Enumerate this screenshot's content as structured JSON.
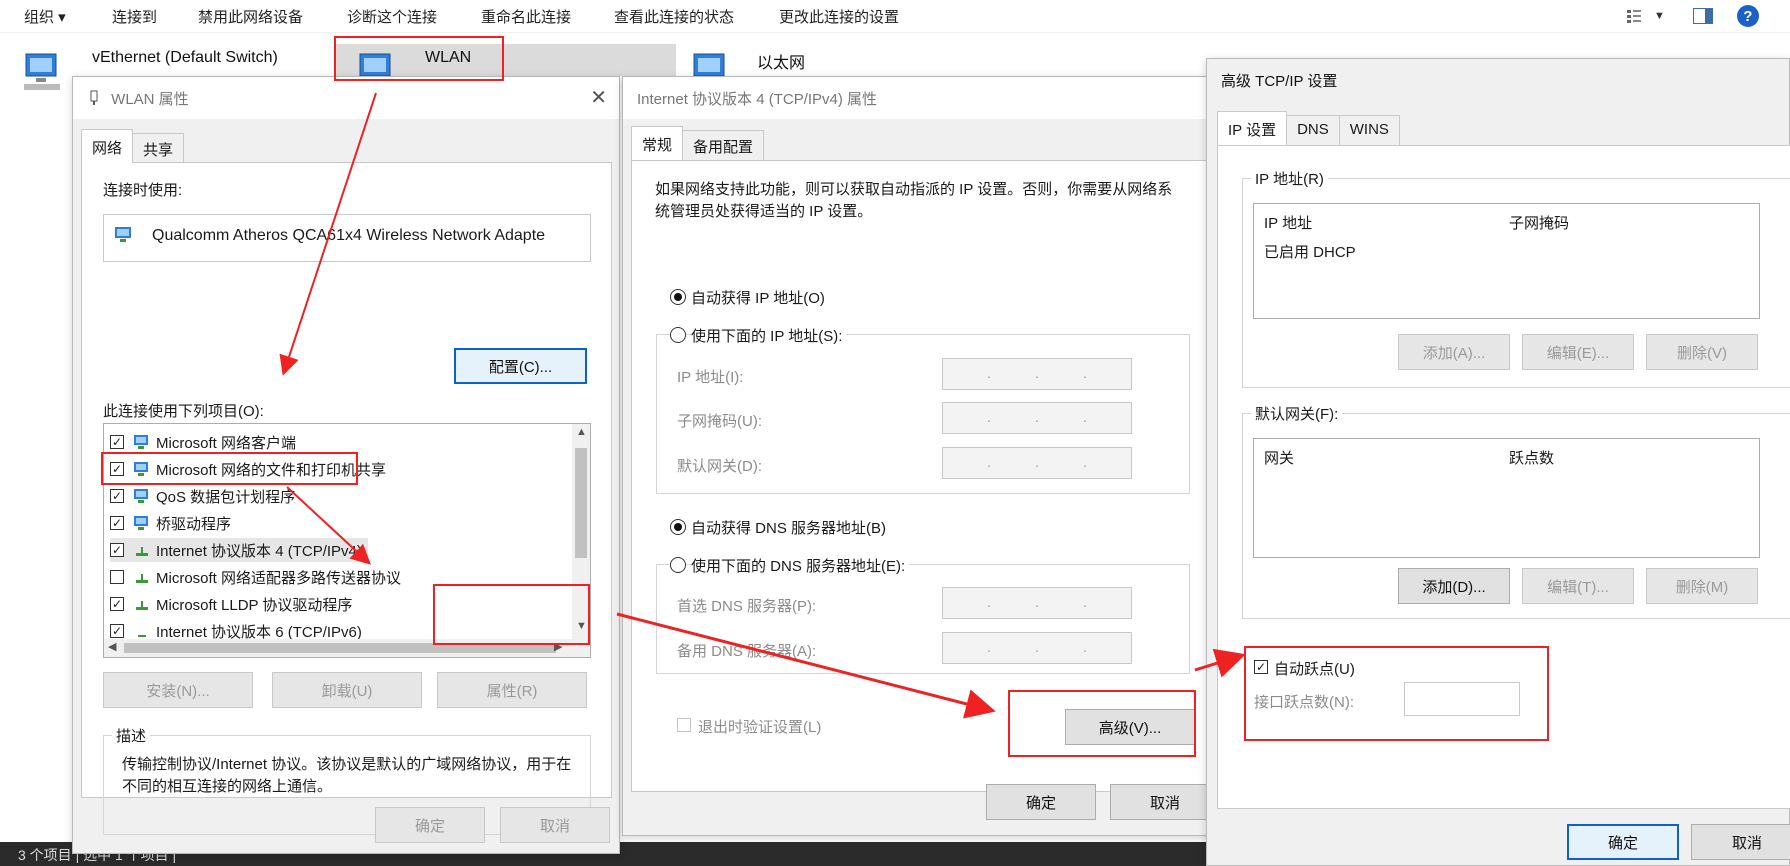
{
  "toolbar": {
    "organize": "组织 ▾",
    "connect_to": "连接到",
    "disable_device": "禁用此网络设备",
    "diagnose": "诊断这个连接",
    "rename": "重命名此连接",
    "view_status": "查看此连接的状态",
    "change_settings": "更改此连接的设置",
    "help": "?"
  },
  "connections": [
    {
      "name": "vEthernet (Default Switch)"
    },
    {
      "name": "WLAN"
    },
    {
      "name": "以太网"
    }
  ],
  "statusbar": {
    "text": "3 个项目  |  选中 1 个项目  |"
  },
  "wlan_props": {
    "title": "WLAN 属性",
    "tabs": [
      "网络",
      "共享"
    ],
    "connect_using_label": "连接时使用:",
    "adapter_name": "Qualcomm Atheros QCA61x4 Wireless Network Adapte",
    "configure_btn": "配置(C)...",
    "items_label": "此连接使用下列项目(O):",
    "items": [
      {
        "checked": "✓",
        "label": "Microsoft 网络客户端"
      },
      {
        "checked": "✓",
        "label": "Microsoft 网络的文件和打印机共享"
      },
      {
        "checked": "✓",
        "label": "QoS 数据包计划程序"
      },
      {
        "checked": "✓",
        "label": "桥驱动程序"
      },
      {
        "checked": "✓",
        "label": "Internet 协议版本 4 (TCP/IPv4)"
      },
      {
        "checked": "",
        "label": "Microsoft 网络适配器多路传送器协议"
      },
      {
        "checked": "✓",
        "label": "Microsoft LLDP 协议驱动程序"
      },
      {
        "checked": "✓",
        "label": "Internet 协议版本 6 (TCP/IPv6)"
      }
    ],
    "install_btn": "安装(N)...",
    "uninstall_btn": "卸载(U)",
    "properties_btn": "属性(R)",
    "description_title": "描述",
    "description_text": "传输控制协议/Internet 协议。该协议是默认的广域网络协议，用于在不同的相互连接的网络上通信。",
    "ok_btn": "确定",
    "cancel_btn": "取消"
  },
  "ipv4_props": {
    "title": "Internet 协议版本 4 (TCP/IPv4) 属性",
    "tabs": [
      "常规",
      "备用配置"
    ],
    "intro": "如果网络支持此功能，则可以获取自动指派的 IP 设置。否则，你需要从网络系统管理员处获得适当的 IP 设置。",
    "auto_ip": "自动获得 IP 地址(O)",
    "manual_ip": "使用下面的 IP 地址(S):",
    "ip_label": "IP 地址(I):",
    "mask_label": "子网掩码(U):",
    "gateway_label": "默认网关(D):",
    "auto_dns": "自动获得 DNS 服务器地址(B)",
    "manual_dns": "使用下面的 DNS 服务器地址(E):",
    "pref_dns_label": "首选 DNS 服务器(P):",
    "alt_dns_label": "备用 DNS 服务器(A):",
    "ip_dots": ".",
    "validate_label": "退出时验证设置(L)",
    "advanced_btn": "高级(V)...",
    "ok_btn": "确定",
    "cancel_btn": "取消"
  },
  "advanced_tcpip": {
    "title": "高级 TCP/IP 设置",
    "tabs": [
      "IP 设置",
      "DNS",
      "WINS"
    ],
    "ip_group": "IP 地址(R)",
    "ip_col1": "IP 地址",
    "ip_col2": "子网掩码",
    "ip_row": "已启用 DHCP",
    "add_ip_btn": "添加(A)...",
    "edit_ip_btn": "编辑(E)...",
    "remove_ip_btn": "删除(V)",
    "gateway_group": "默认网关(F):",
    "gw_col1": "网关",
    "gw_col2": "跃点数",
    "add_gw_btn": "添加(D)...",
    "edit_gw_btn": "编辑(T)...",
    "remove_gw_btn": "删除(M)",
    "auto_metric_checked": "✓",
    "auto_metric_label": "自动跃点(U)",
    "interface_metric_label": "接口跃点数(N):",
    "ok_btn": "确定",
    "cancel_btn": "取消"
  },
  "annotation_color": "#ee2222"
}
